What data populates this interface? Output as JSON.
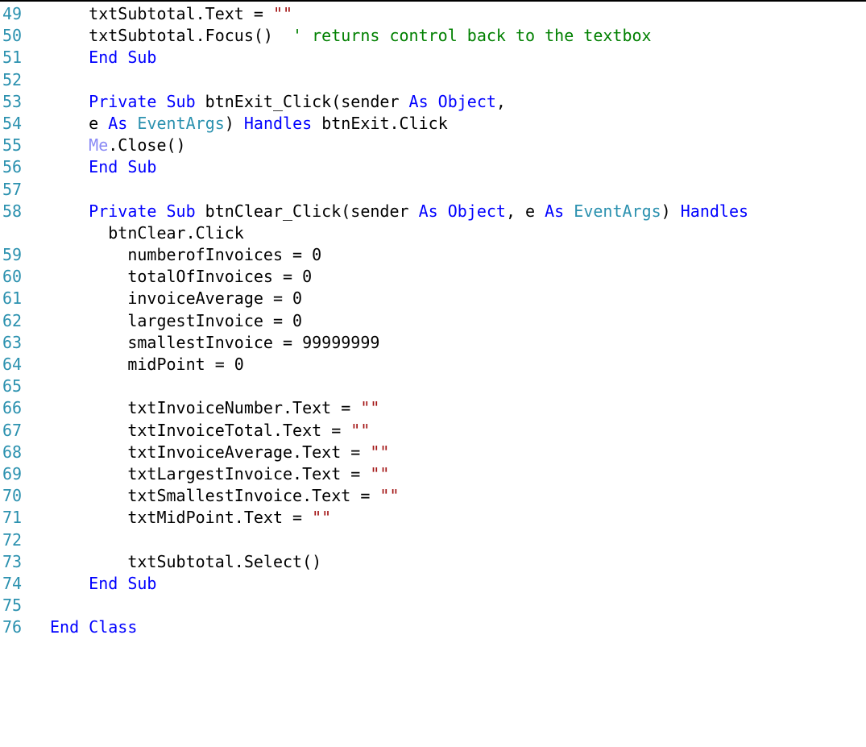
{
  "colors": {
    "line_number": "#2B91AF",
    "keyword": "#0000FF",
    "type": "#2B91AF",
    "string": "#A31515",
    "comment": "#008000",
    "me_keyword": "#8A8AF5",
    "text": "#000000"
  },
  "lines": [
    {
      "num": "49",
      "tokens": [
        {
          "t": "txt",
          "v": "    txtSubtotal.Text = "
        },
        {
          "t": "str",
          "v": "\"\""
        }
      ]
    },
    {
      "num": "50",
      "tokens": [
        {
          "t": "txt",
          "v": "    txtSubtotal.Focus()  "
        },
        {
          "t": "cm",
          "v": "' returns control back to the textbox"
        }
      ]
    },
    {
      "num": "51",
      "tokens": [
        {
          "t": "kw",
          "v": "End Sub"
        }
      ]
    },
    {
      "num": "52",
      "tokens": []
    },
    {
      "num": "53",
      "tokens": [
        {
          "t": "kw",
          "v": "Private Sub"
        },
        {
          "t": "txt",
          "v": " btnExit_Click(sender "
        },
        {
          "t": "kw",
          "v": "As"
        },
        {
          "t": "txt",
          "v": " "
        },
        {
          "t": "kw",
          "v": "Object"
        },
        {
          "t": "txt",
          "v": ","
        }
      ]
    },
    {
      "num": "54",
      "tokens": [
        {
          "t": "txt",
          "v": "      e "
        },
        {
          "t": "kw",
          "v": "As"
        },
        {
          "t": "txt",
          "v": " "
        },
        {
          "t": "type",
          "v": "EventArgs"
        },
        {
          "t": "txt",
          "v": ") "
        },
        {
          "t": "kw",
          "v": "Handles"
        },
        {
          "t": "txt",
          "v": " btnExit.Click"
        }
      ]
    },
    {
      "num": "55",
      "tokens": [
        {
          "t": "me",
          "v": "    Me"
        },
        {
          "t": "txt",
          "v": ".Close()"
        }
      ]
    },
    {
      "num": "56",
      "tokens": [
        {
          "t": "kw",
          "v": "End Sub"
        }
      ]
    },
    {
      "num": "57",
      "tokens": []
    },
    {
      "num": "58",
      "tokens": [
        {
          "t": "kw",
          "v": "Private Sub"
        },
        {
          "t": "txt",
          "v": " btnClear_Click(sender "
        },
        {
          "t": "kw",
          "v": "As"
        },
        {
          "t": "txt",
          "v": " "
        },
        {
          "t": "kw",
          "v": "Object"
        },
        {
          "t": "txt",
          "v": ", e "
        },
        {
          "t": "kw",
          "v": "As"
        },
        {
          "t": "txt",
          "v": " "
        },
        {
          "t": "type",
          "v": "EventArgs"
        },
        {
          "t": "txt",
          "v": ") "
        },
        {
          "t": "kw",
          "v": "Handles"
        }
      ]
    },
    {
      "num": "",
      "tokens": [
        {
          "t": "txt",
          "v": "  btnClear.Click"
        }
      ]
    },
    {
      "num": "59",
      "tokens": [
        {
          "t": "txt",
          "v": "    numberofInvoices = 0"
        }
      ]
    },
    {
      "num": "60",
      "tokens": [
        {
          "t": "txt",
          "v": "    totalOfInvoices = 0"
        }
      ]
    },
    {
      "num": "61",
      "tokens": [
        {
          "t": "txt",
          "v": "    invoiceAverage = 0"
        }
      ]
    },
    {
      "num": "62",
      "tokens": [
        {
          "t": "txt",
          "v": "    largestInvoice = 0"
        }
      ]
    },
    {
      "num": "63",
      "tokens": [
        {
          "t": "txt",
          "v": "    smallestInvoice = 99999999"
        }
      ]
    },
    {
      "num": "64",
      "tokens": [
        {
          "t": "txt",
          "v": "    midPoint = 0"
        }
      ]
    },
    {
      "num": "65",
      "tokens": []
    },
    {
      "num": "66",
      "tokens": [
        {
          "t": "txt",
          "v": "    txtInvoiceNumber.Text = "
        },
        {
          "t": "str",
          "v": "\"\""
        }
      ]
    },
    {
      "num": "67",
      "tokens": [
        {
          "t": "txt",
          "v": "    txtInvoiceTotal.Text = "
        },
        {
          "t": "str",
          "v": "\"\""
        }
      ]
    },
    {
      "num": "68",
      "tokens": [
        {
          "t": "txt",
          "v": "    txtInvoiceAverage.Text = "
        },
        {
          "t": "str",
          "v": "\"\""
        }
      ]
    },
    {
      "num": "69",
      "tokens": [
        {
          "t": "txt",
          "v": "    txtLargestInvoice.Text = "
        },
        {
          "t": "str",
          "v": "\"\""
        }
      ]
    },
    {
      "num": "70",
      "tokens": [
        {
          "t": "txt",
          "v": "    txtSmallestInvoice.Text = "
        },
        {
          "t": "str",
          "v": "\"\""
        }
      ]
    },
    {
      "num": "71",
      "tokens": [
        {
          "t": "txt",
          "v": "    txtMidPoint.Text = "
        },
        {
          "t": "str",
          "v": "\"\""
        }
      ]
    },
    {
      "num": "72",
      "tokens": []
    },
    {
      "num": "73",
      "tokens": [
        {
          "t": "txt",
          "v": "    txtSubtotal.Select()"
        }
      ]
    },
    {
      "num": "74",
      "tokens": [
        {
          "t": "kw",
          "v": "End Sub"
        }
      ]
    },
    {
      "num": "75",
      "tokens": []
    },
    {
      "num": "76",
      "tokens": [
        {
          "t": "kw",
          "v": "End Class"
        }
      ]
    }
  ]
}
